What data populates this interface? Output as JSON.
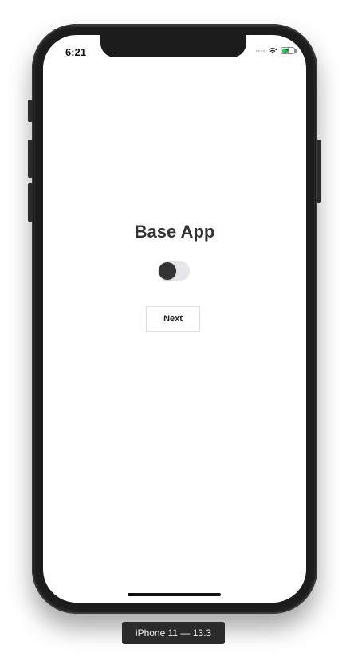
{
  "status_bar": {
    "time": "6:21",
    "icons": [
      "cellular-signal-icon",
      "wifi-icon",
      "battery-charging-icon"
    ],
    "battery_color": "#34c759"
  },
  "app": {
    "title": "Base App",
    "toggle": {
      "state": "off",
      "knob_color": "#333333",
      "track_color": "#e5e5ea"
    },
    "next_button_label": "Next"
  },
  "device_label": "iPhone 11 — 13.3"
}
